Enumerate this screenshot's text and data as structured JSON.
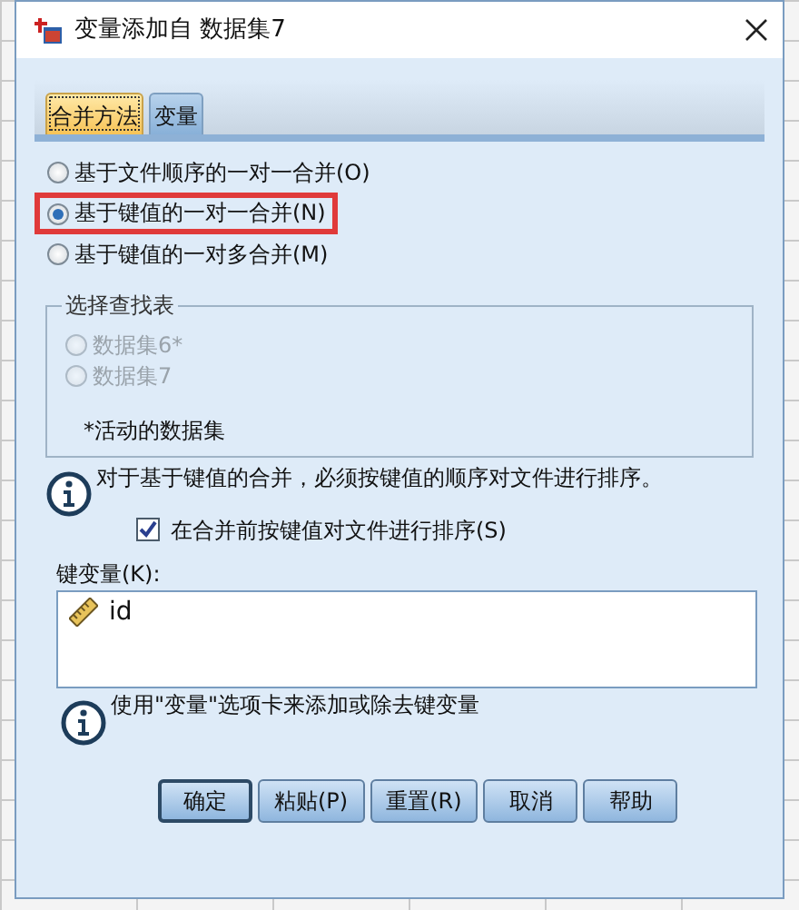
{
  "window": {
    "title": "变量添加自 数据集7"
  },
  "tabs": [
    {
      "label": "合并方法",
      "selected": true
    },
    {
      "label": "变量",
      "selected": false
    }
  ],
  "merge_methods": [
    {
      "label": "基于文件顺序的一对一合并(O)",
      "selected": false,
      "highlighted": false
    },
    {
      "label": "基于键值的一对一合并(N)",
      "selected": true,
      "highlighted": true
    },
    {
      "label": "基于键值的一对多合并(M)",
      "selected": false,
      "highlighted": false
    }
  ],
  "lookup_table": {
    "title": "选择查找表",
    "options": [
      {
        "label": "数据集6*",
        "selected": false,
        "disabled": true
      },
      {
        "label": "数据集7",
        "selected": false,
        "disabled": true
      }
    ],
    "note": "*活动的数据集"
  },
  "sort_info": "对于基于键值的合并，必须按键值的顺序对文件进行排序。",
  "sort_checkbox": {
    "label": "在合并前按键值对文件进行排序(S)",
    "checked": true
  },
  "key_variables": {
    "label": "键变量(K):",
    "items": [
      "id"
    ]
  },
  "key_info": "使用\"变量\"选项卡来添加或除去键变量",
  "buttons": [
    {
      "label": "确定",
      "default": true
    },
    {
      "label": "粘贴(P)",
      "default": false
    },
    {
      "label": "重置(R)",
      "default": false
    },
    {
      "label": "取消",
      "default": false
    },
    {
      "label": "帮助",
      "default": false
    }
  ]
}
